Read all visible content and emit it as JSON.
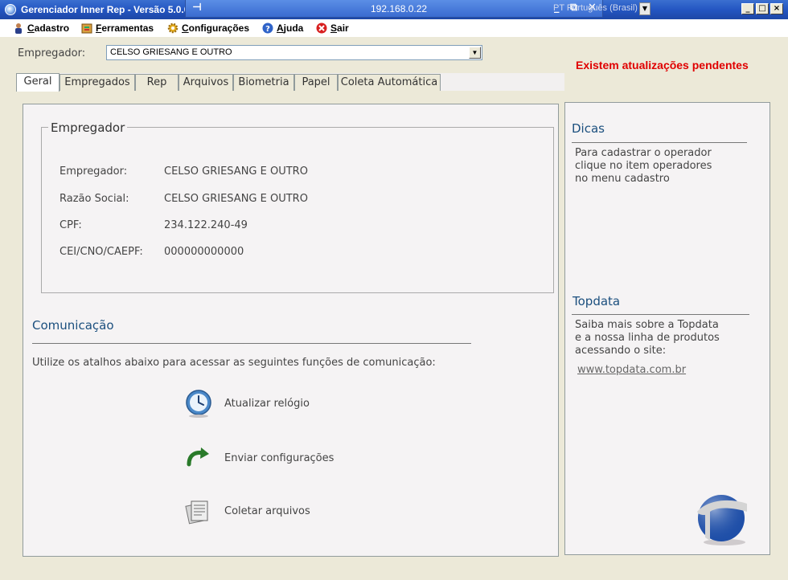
{
  "window": {
    "title": "Gerenciador Inner Rep - Versão 5.0.0",
    "rdp_host": "192.168.0.22",
    "language": "PT Português (Brasil)",
    "buttons": {
      "minimize": "_",
      "maximize": "□",
      "close": "×"
    }
  },
  "menu": {
    "items": [
      {
        "label": "Cadastro",
        "icon": "user-icon"
      },
      {
        "label": "Ferramentas",
        "icon": "tools-icon"
      },
      {
        "label": "Configurações",
        "icon": "gear-icon"
      },
      {
        "label": "Ajuda",
        "icon": "help-icon"
      },
      {
        "label": "Sair",
        "icon": "exit-icon"
      }
    ]
  },
  "employer_selector": {
    "label": "Empregador:",
    "value": "CELSO GRIESANG E OUTRO"
  },
  "notice": "Existem atualizações pendentes",
  "tabs": [
    {
      "label": "Geral",
      "active": true
    },
    {
      "label": "Empregados"
    },
    {
      "label": "Rep"
    },
    {
      "label": "Arquivos"
    },
    {
      "label": "Biometria"
    },
    {
      "label": "Papel"
    },
    {
      "label": "Coleta Automática"
    }
  ],
  "employer_group": {
    "legend": "Empregador",
    "fields": [
      {
        "label": "Empregador:",
        "value": "CELSO GRIESANG E OUTRO"
      },
      {
        "label": "Razão Social:",
        "value": "CELSO GRIESANG E OUTRO"
      },
      {
        "label": "CPF:",
        "value": "234.122.240-49"
      },
      {
        "label": "CEI/CNO/CAEPF:",
        "value": "000000000000"
      }
    ]
  },
  "communication": {
    "title": "Comunicação",
    "description": "Utilize os atalhos abaixo para acessar as seguintes funções de comunicação:",
    "actions": [
      {
        "label": "Atualizar relógio",
        "icon": "clock-icon"
      },
      {
        "label": "Enviar configurações",
        "icon": "send-arrow-icon"
      },
      {
        "label": "Coletar arquivos",
        "icon": "files-icon"
      }
    ]
  },
  "sidebar": {
    "tips_title": "Dicas",
    "tips_lines": [
      "Para cadastrar o operador",
      "clique no item operadores",
      "no menu cadastro"
    ],
    "topdata_title": "Topdata",
    "topdata_lines": [
      "Saiba mais sobre a Topdata",
      "e a nossa linha de produtos",
      "acessando o site:"
    ],
    "topdata_link": "www.topdata.com.br"
  },
  "colors": {
    "accent_title": "#1b4f7e",
    "notice": "#e00000",
    "titlebar": "#2456c2"
  }
}
